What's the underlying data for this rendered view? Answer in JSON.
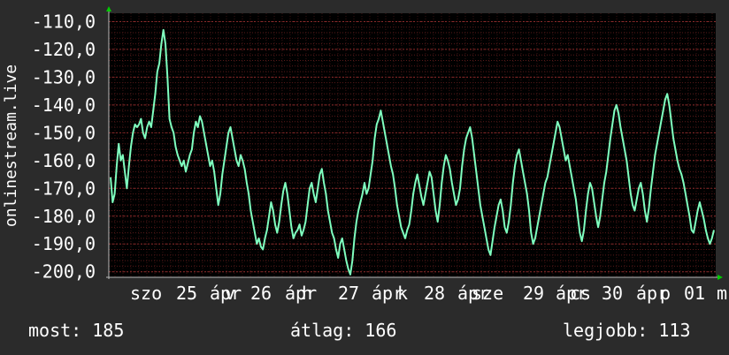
{
  "chart_data": {
    "type": "line",
    "ylabel": "onlinestream.live",
    "ylim": [
      -202,
      -107
    ],
    "yticks": [
      "-110,0",
      "-120,0",
      "-130,0",
      "-140,0",
      "-150,0",
      "-160,0",
      "-170,0",
      "-180,0",
      "-190,0",
      "-200,0"
    ],
    "ytick_values": [
      -110,
      -120,
      -130,
      -140,
      -150,
      -160,
      -170,
      -180,
      -190,
      -200
    ],
    "xticks": [
      "szo",
      "25",
      "ápr",
      "v",
      "26",
      "ápr",
      "h",
      "27",
      "ápr",
      "k",
      "28",
      "ápr",
      "sze",
      "29",
      "ápr",
      "cs",
      "30",
      "ápr",
      "p",
      "01",
      "m"
    ],
    "grid": true,
    "colors": {
      "background": "#2b2b2b",
      "plot": "#000000",
      "line": "#7fffbf",
      "grid": "#5a1a1a",
      "axis": "#ffffff",
      "arrow": "#00cc00"
    },
    "series": [
      {
        "values": [
          -166,
          -175,
          -172,
          -162,
          -154,
          -160,
          -158,
          -164,
          -170,
          -162,
          -155,
          -150,
          -147,
          -148,
          -147,
          -145,
          -150,
          -152,
          -148,
          -146,
          -148,
          -142,
          -136,
          -128,
          -125,
          -118,
          -113,
          -118,
          -130,
          -145,
          -148,
          -150,
          -155,
          -158,
          -160,
          -162,
          -160,
          -164,
          -161,
          -158,
          -156,
          -150,
          -146,
          -148,
          -144,
          -146,
          -150,
          -154,
          -158,
          -162,
          -160,
          -164,
          -170,
          -176,
          -172,
          -165,
          -160,
          -155,
          -150,
          -148,
          -152,
          -156,
          -160,
          -162,
          -158,
          -160,
          -163,
          -168,
          -172,
          -178,
          -182,
          -186,
          -190,
          -188,
          -191,
          -192,
          -188,
          -185,
          -180,
          -175,
          -178,
          -183,
          -186,
          -182,
          -176,
          -171,
          -168,
          -172,
          -178,
          -184,
          -188,
          -186,
          -185,
          -183,
          -187,
          -185,
          -182,
          -176,
          -170,
          -168,
          -172,
          -175,
          -170,
          -165,
          -163,
          -168,
          -172,
          -178,
          -182,
          -186,
          -188,
          -192,
          -195,
          -190,
          -188,
          -192,
          -196,
          -199,
          -201,
          -196,
          -188,
          -182,
          -178,
          -175,
          -172,
          -168,
          -172,
          -170,
          -165,
          -160,
          -152,
          -147,
          -145,
          -142,
          -146,
          -150,
          -154,
          -158,
          -162,
          -165,
          -170,
          -176,
          -180,
          -184,
          -186,
          -188,
          -185,
          -183,
          -178,
          -172,
          -168,
          -165,
          -169,
          -173,
          -176,
          -172,
          -168,
          -164,
          -166,
          -172,
          -178,
          -182,
          -176,
          -168,
          -162,
          -158,
          -160,
          -163,
          -168,
          -172,
          -176,
          -174,
          -170,
          -162,
          -156,
          -152,
          -150,
          -148,
          -152,
          -158,
          -164,
          -170,
          -176,
          -180,
          -184,
          -188,
          -192,
          -194,
          -189,
          -184,
          -180,
          -176,
          -174,
          -178,
          -184,
          -186,
          -182,
          -176,
          -168,
          -162,
          -158,
          -156,
          -160,
          -164,
          -168,
          -172,
          -178,
          -186,
          -190,
          -188,
          -184,
          -180,
          -176,
          -172,
          -168,
          -166,
          -162,
          -158,
          -154,
          -150,
          -146,
          -148,
          -152,
          -156,
          -160,
          -158,
          -162,
          -166,
          -170,
          -174,
          -180,
          -186,
          -189,
          -185,
          -178,
          -172,
          -168,
          -170,
          -175,
          -180,
          -184,
          -180,
          -174,
          -168,
          -164,
          -158,
          -152,
          -147,
          -142,
          -140,
          -143,
          -148,
          -152,
          -156,
          -160,
          -166,
          -172,
          -176,
          -178,
          -174,
          -170,
          -168,
          -172,
          -178,
          -182,
          -177,
          -170,
          -164,
          -158,
          -154,
          -150,
          -146,
          -142,
          -138,
          -136,
          -140,
          -146,
          -152,
          -156,
          -160,
          -163,
          -165,
          -168,
          -172,
          -176,
          -180,
          -185,
          -186,
          -182,
          -178,
          -175,
          -178,
          -181,
          -185,
          -188,
          -190,
          -188,
          -185
        ]
      }
    ]
  },
  "stats": {
    "most": "most: 185",
    "avg": "átlag: 166",
    "best": "legjobb: 113"
  }
}
